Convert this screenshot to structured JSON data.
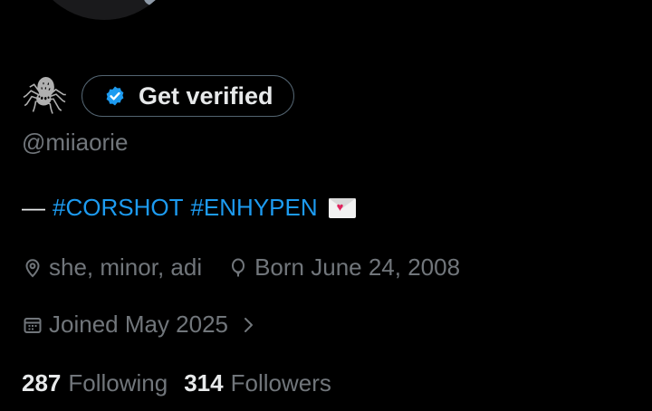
{
  "profile": {
    "avatar_icon": "avatar-image",
    "display_emoji": "🕷",
    "get_verified_label": "Get verified",
    "handle": "@miiaorie",
    "bio": {
      "prefix": "—",
      "hashtags": [
        "#CORSHOT",
        "#ENHYPEN"
      ],
      "emoji_icon": "love-letter-icon"
    },
    "info": {
      "pronouns": "she, minor, adi",
      "birthday": "Born June 24, 2008",
      "joined": "Joined May 2025"
    },
    "stats": {
      "following_count": "287",
      "following_label": "Following",
      "followers_count": "314",
      "followers_label": "Followers"
    }
  },
  "colors": {
    "background": "#000000",
    "text_primary": "#e7e9ea",
    "text_secondary": "#71767b",
    "accent": "#1d9bf0",
    "border": "#536471"
  }
}
